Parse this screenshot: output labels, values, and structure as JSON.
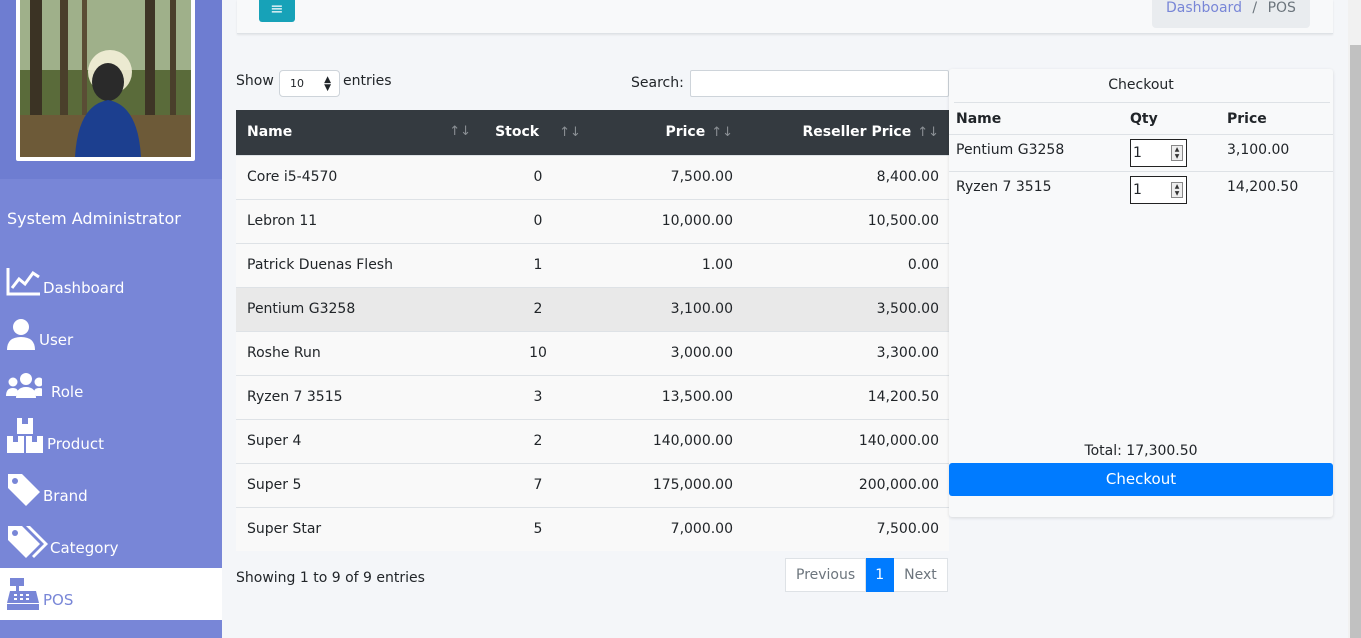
{
  "sidebar": {
    "user_name": "System Administrator",
    "items": [
      {
        "label": "Dashboard",
        "icon": "chart-line-icon"
      },
      {
        "label": "User",
        "icon": "user-icon"
      },
      {
        "label": "Role",
        "icon": "users-icon"
      },
      {
        "label": "Product",
        "icon": "boxes-icon"
      },
      {
        "label": "Brand",
        "icon": "tag-icon"
      },
      {
        "label": "Category",
        "icon": "tags-icon"
      },
      {
        "label": "POS",
        "icon": "cash-register-icon",
        "active": true
      }
    ]
  },
  "topbar": {
    "menu_icon": "≡",
    "breadcrumb": {
      "link": "Dashboard",
      "separator": "/",
      "current": "POS"
    }
  },
  "table_controls": {
    "show_label": "Show",
    "length_value": "10",
    "entries_label": "entries",
    "search_label": "Search:",
    "search_value": ""
  },
  "products": {
    "columns": [
      "Name",
      "Stock",
      "Price",
      "Reseller Price"
    ],
    "rows": [
      {
        "name": "Core i5-4570",
        "stock": "0",
        "price": "7,500.00",
        "reseller": "8,400.00"
      },
      {
        "name": "Lebron 11",
        "stock": "0",
        "price": "10,000.00",
        "reseller": "10,500.00"
      },
      {
        "name": "Patrick Duenas Flesh",
        "stock": "1",
        "price": "1.00",
        "reseller": "0.00"
      },
      {
        "name": "Pentium G3258",
        "stock": "2",
        "price": "3,100.00",
        "reseller": "3,500.00"
      },
      {
        "name": "Roshe Run",
        "stock": "10",
        "price": "3,000.00",
        "reseller": "3,300.00"
      },
      {
        "name": "Ryzen 7 3515",
        "stock": "3",
        "price": "13,500.00",
        "reseller": "14,200.50"
      },
      {
        "name": "Super 4",
        "stock": "2",
        "price": "140,000.00",
        "reseller": "140,000.00"
      },
      {
        "name": "Super 5",
        "stock": "7",
        "price": "175,000.00",
        "reseller": "200,000.00"
      },
      {
        "name": "Super Star",
        "stock": "5",
        "price": "7,000.00",
        "reseller": "7,500.00"
      }
    ],
    "info": "Showing 1 to 9 of 9 entries",
    "pager": {
      "previous": "Previous",
      "current": "1",
      "next": "Next"
    }
  },
  "cart": {
    "title": "Checkout",
    "columns": [
      "Name",
      "Qty",
      "Price"
    ],
    "items": [
      {
        "name": "Pentium G3258",
        "qty": "1",
        "price": "3,100.00"
      },
      {
        "name": "Ryzen 7 3515",
        "qty": "1",
        "price": "14,200.50"
      }
    ],
    "total": "Total: 17,300.50",
    "checkout_label": "Checkout"
  },
  "colors": {
    "sidebar": "#7886d7",
    "table_header": "#343a40",
    "primary": "#007bff",
    "menu_button": "#17a2b8"
  }
}
